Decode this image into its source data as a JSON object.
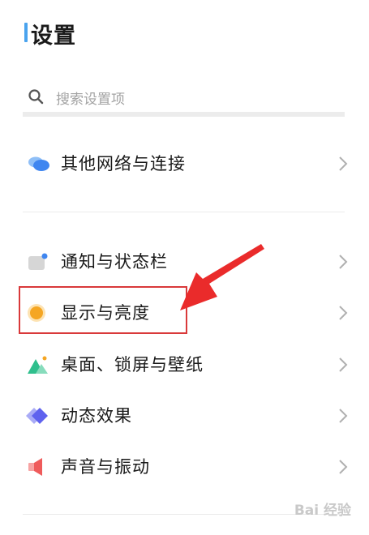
{
  "header": {
    "title": "设置"
  },
  "search": {
    "placeholder": "搜索设置项"
  },
  "items": [
    {
      "label": "其他网络与连接",
      "icon": "cloud-icon",
      "color": "#4a8ff0"
    },
    {
      "label": "通知与状态栏",
      "icon": "notification-icon",
      "color": "#d4d4d4"
    },
    {
      "label": "显示与亮度",
      "icon": "brightness-icon",
      "color": "#f5a623"
    },
    {
      "label": "桌面、锁屏与壁纸",
      "icon": "wallpaper-icon",
      "color": "#32c28e"
    },
    {
      "label": "动态效果",
      "icon": "animation-icon",
      "color": "#6b6ef0"
    },
    {
      "label": "声音与振动",
      "icon": "speaker-icon",
      "color": "#ef6a6a"
    }
  ],
  "annotation": {
    "highlight_color": "#d9393a",
    "arrow_color": "#ea2b2b"
  },
  "watermark": {
    "text": "Bai 经验"
  }
}
